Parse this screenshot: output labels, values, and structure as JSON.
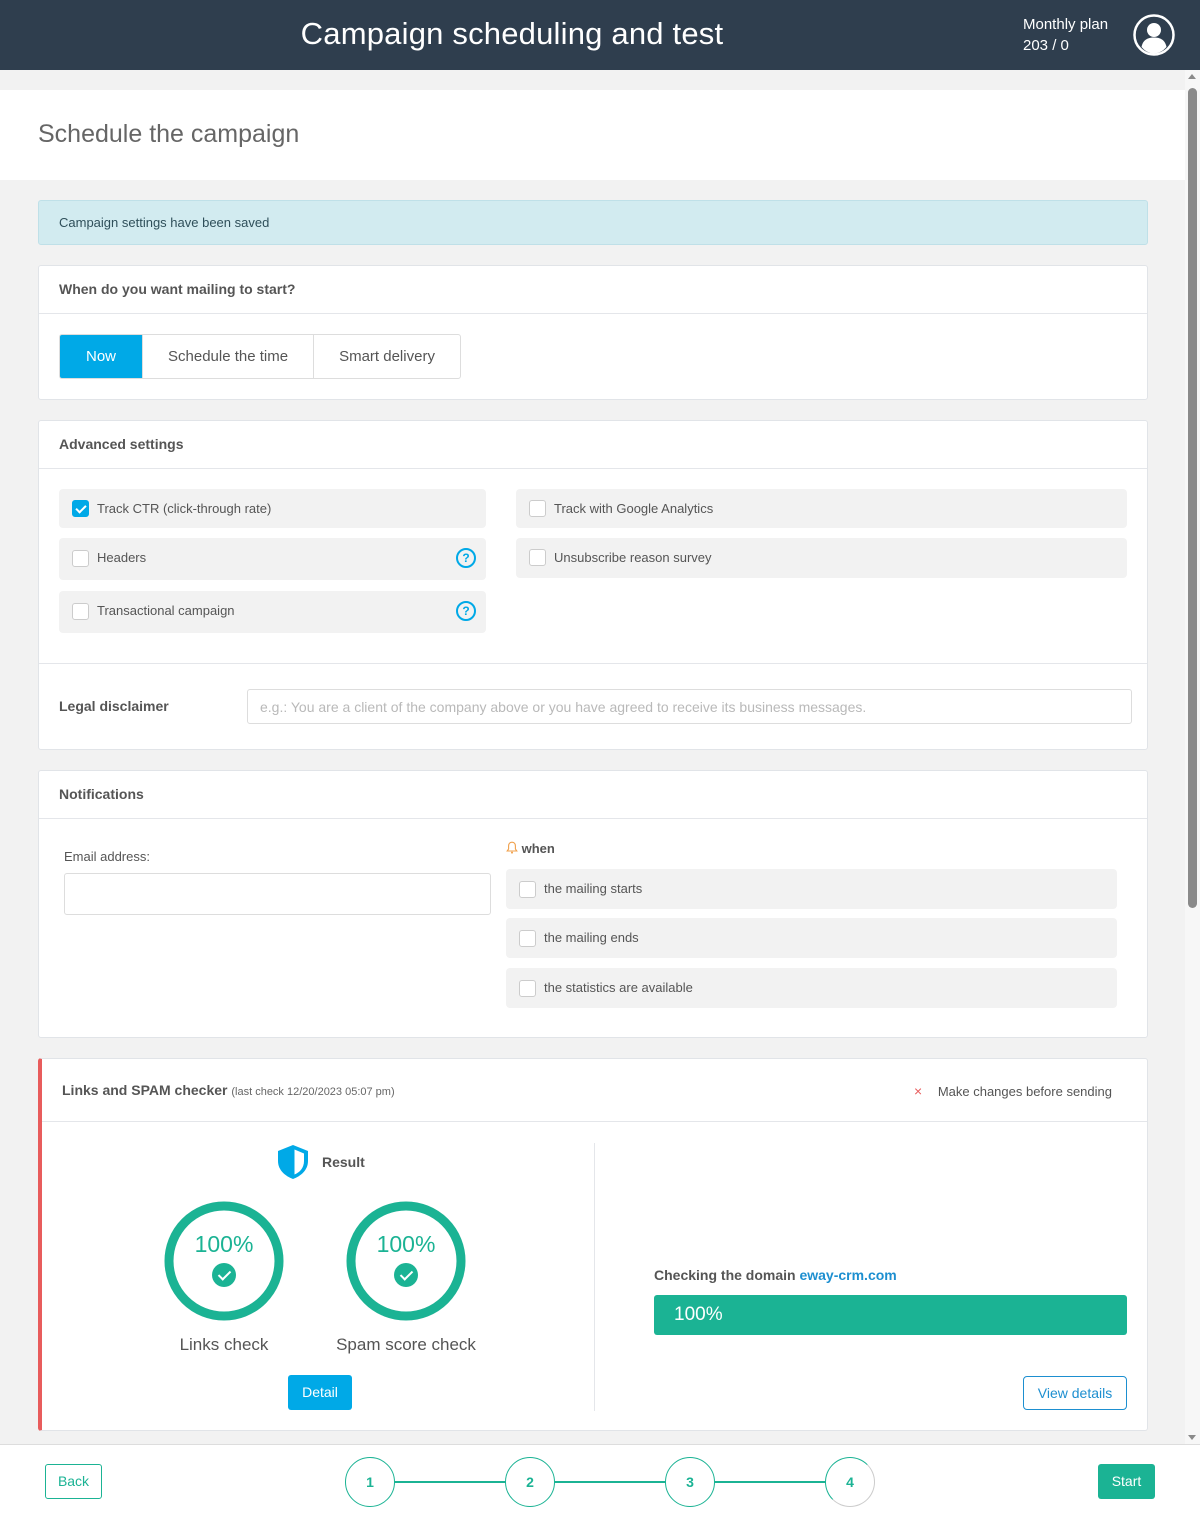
{
  "header": {
    "title": "Campaign scheduling and test",
    "plan_label": "Monthly plan",
    "plan_value": "203 / 0",
    "avatar_icon": "user-circle-icon"
  },
  "page": {
    "heading": "Schedule the campaign"
  },
  "alert": {
    "message": "Campaign settings have been saved"
  },
  "start_card": {
    "title": "When do you want mailing to start?",
    "options": [
      {
        "label": "Now",
        "selected": true
      },
      {
        "label": "Schedule the time",
        "selected": false
      },
      {
        "label": "Smart delivery",
        "selected": false
      }
    ]
  },
  "advanced": {
    "title": "Advanced settings",
    "options": [
      {
        "label": "Track CTR (click-through rate)",
        "checked": true,
        "help": false
      },
      {
        "label": "Headers",
        "checked": false,
        "help": true
      },
      {
        "label": "Transactional campaign",
        "checked": false,
        "help": true
      },
      {
        "label": "Track with Google Analytics",
        "checked": false,
        "help": false
      },
      {
        "label": "Unsubscribe reason survey",
        "checked": false,
        "help": false
      }
    ],
    "help_glyph": "?",
    "legal_label": "Legal disclaimer",
    "legal_value": "",
    "legal_placeholder": "e.g.: You are a client of the company above or you have agreed to receive its business messages."
  },
  "notifications": {
    "title": "Notifications",
    "email_label": "Email address:",
    "email_value": "",
    "when_label": "when",
    "when_icon": "bell-icon",
    "options": [
      {
        "label": "the mailing starts",
        "checked": false
      },
      {
        "label": "the mailing ends",
        "checked": false
      },
      {
        "label": "the statistics are available",
        "checked": false
      }
    ]
  },
  "spam_checker": {
    "title": "Links and SPAM checker",
    "subtitle": "(last check 12/20/2023 05:07 pm)",
    "warning_icon": "×",
    "warning": "Make changes before sending",
    "status_color": "#e85c5c",
    "result_label": "Result",
    "result_icon": "shield-icon",
    "checks": [
      {
        "label": "Links check",
        "percent": 100,
        "percent_text": "100%"
      },
      {
        "label": "Spam score check",
        "percent": 100,
        "percent_text": "100%"
      }
    ],
    "detail_button": "Detail",
    "domain_prefix": "Checking the domain",
    "domain": "eway-crm.com",
    "domain_progress": 100,
    "domain_progress_text": "100%",
    "view_details_button": "View details"
  },
  "footer": {
    "back_button": "Back",
    "start_button": "Start",
    "steps": [
      "1",
      "2",
      "3",
      "4"
    ],
    "current_step": 4
  },
  "colors": {
    "header_bg": "#2f3e4e",
    "accent_blue": "#00a9e7",
    "success_green": "#1bb394",
    "link_blue": "#1d8fd0",
    "alert_bg": "#d2ebf0",
    "bell_orange": "#f0a04b"
  }
}
